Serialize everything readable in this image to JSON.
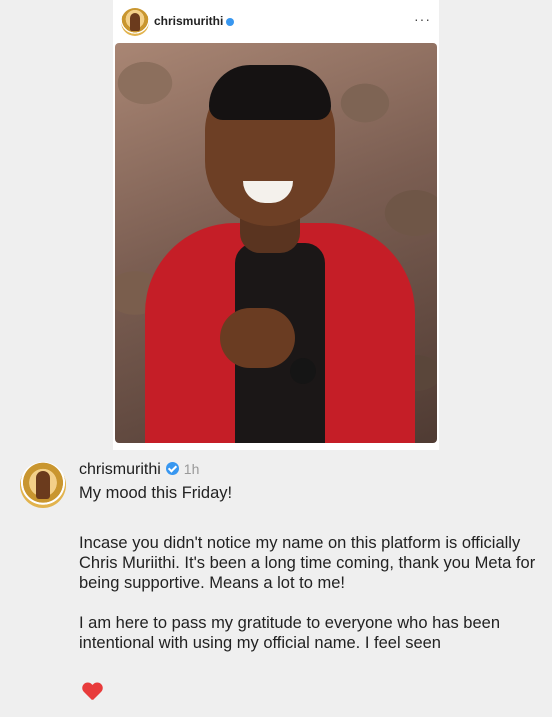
{
  "post": {
    "username": "chrismurithi",
    "more_icon": "more-dots-icon",
    "avatar_icon": "profile-avatar",
    "photo_alt": "profile-photo"
  },
  "comment": {
    "username": "chrismurithi",
    "time": "1h",
    "line1": "My mood this Friday!",
    "para2": "Incase you didn't notice my name on this platform is officially Chris Muriithi. It's been a long time coming, thank you Meta for being supportive. Means a lot to me!",
    "para3": "I am here to pass my gratitude to everyone who has been intentional with using my official name. I feel seen",
    "emoji_icon": "heart-icon"
  },
  "colors": {
    "verified": "#3897f0",
    "heart": "#e83b3b",
    "background": "#efefef"
  }
}
